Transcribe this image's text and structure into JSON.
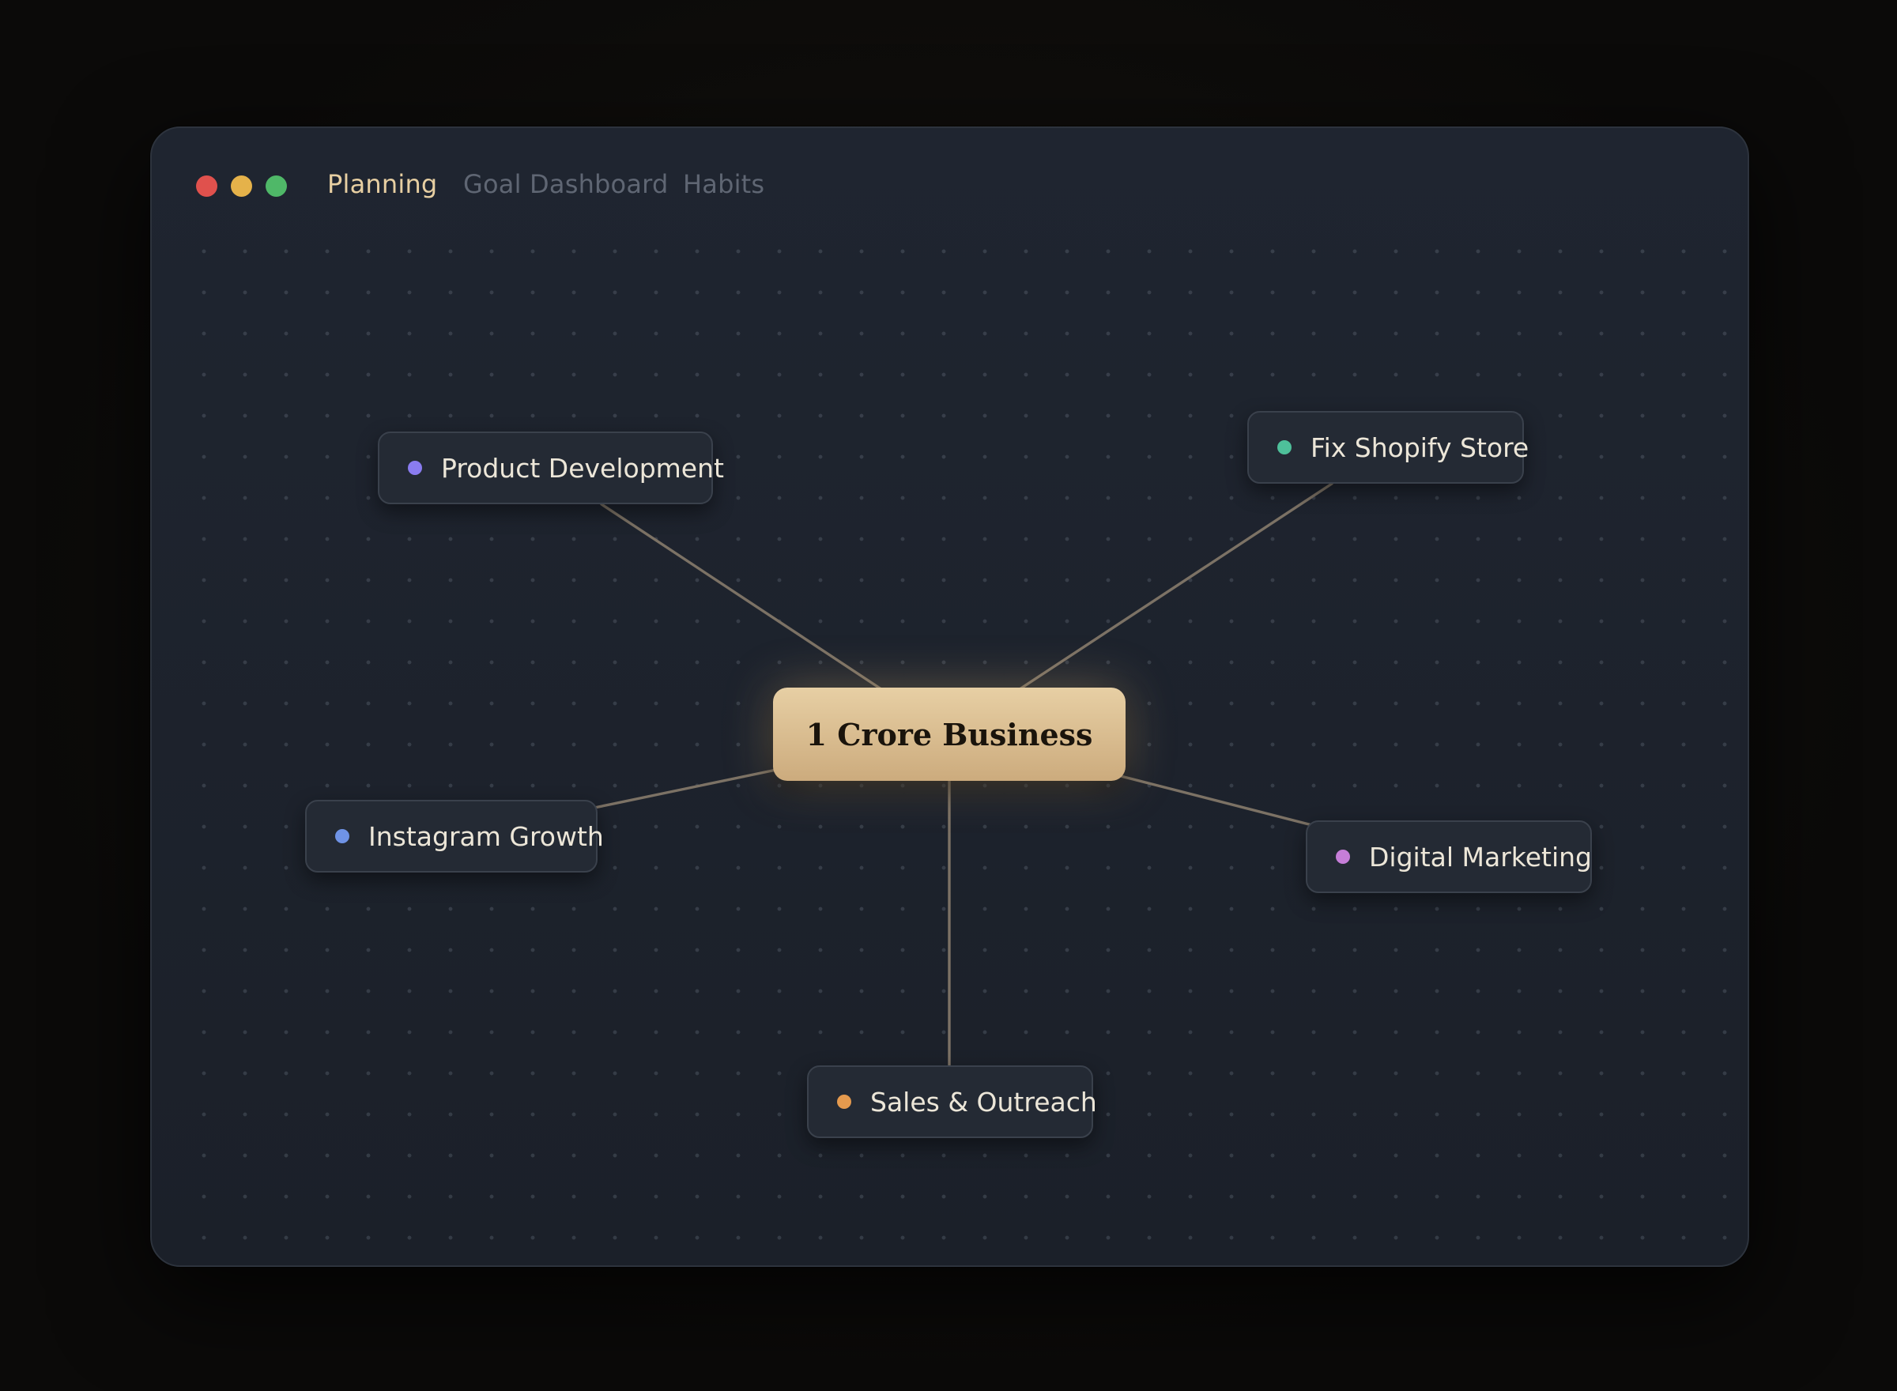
{
  "window": {
    "tabs": [
      {
        "label": "Planning",
        "active": true
      },
      {
        "label": "Goal Dashboard",
        "active": false
      },
      {
        "label": "Habits",
        "active": false
      }
    ],
    "traffic_lights": [
      "#e0514d",
      "#e5b24a",
      "#4fb868"
    ]
  },
  "mindmap": {
    "center": {
      "label": "1 Crore Business",
      "color": "#e7cfa4"
    },
    "nodes": [
      {
        "label": "Product Development",
        "color": "#8a7cf0",
        "icon": "dot"
      },
      {
        "label": "Fix Shopify Store",
        "color": "#4ec09a",
        "icon": "dot"
      },
      {
        "label": "Instagram Growth",
        "color": "#6f93e6",
        "icon": "dot"
      },
      {
        "label": "Digital Marketing",
        "color": "#c67ed8",
        "icon": "dot"
      },
      {
        "label": "Sales & Outreach",
        "color": "#e59a4e",
        "icon": "dot"
      }
    ],
    "connector_color": "#7c7265"
  }
}
